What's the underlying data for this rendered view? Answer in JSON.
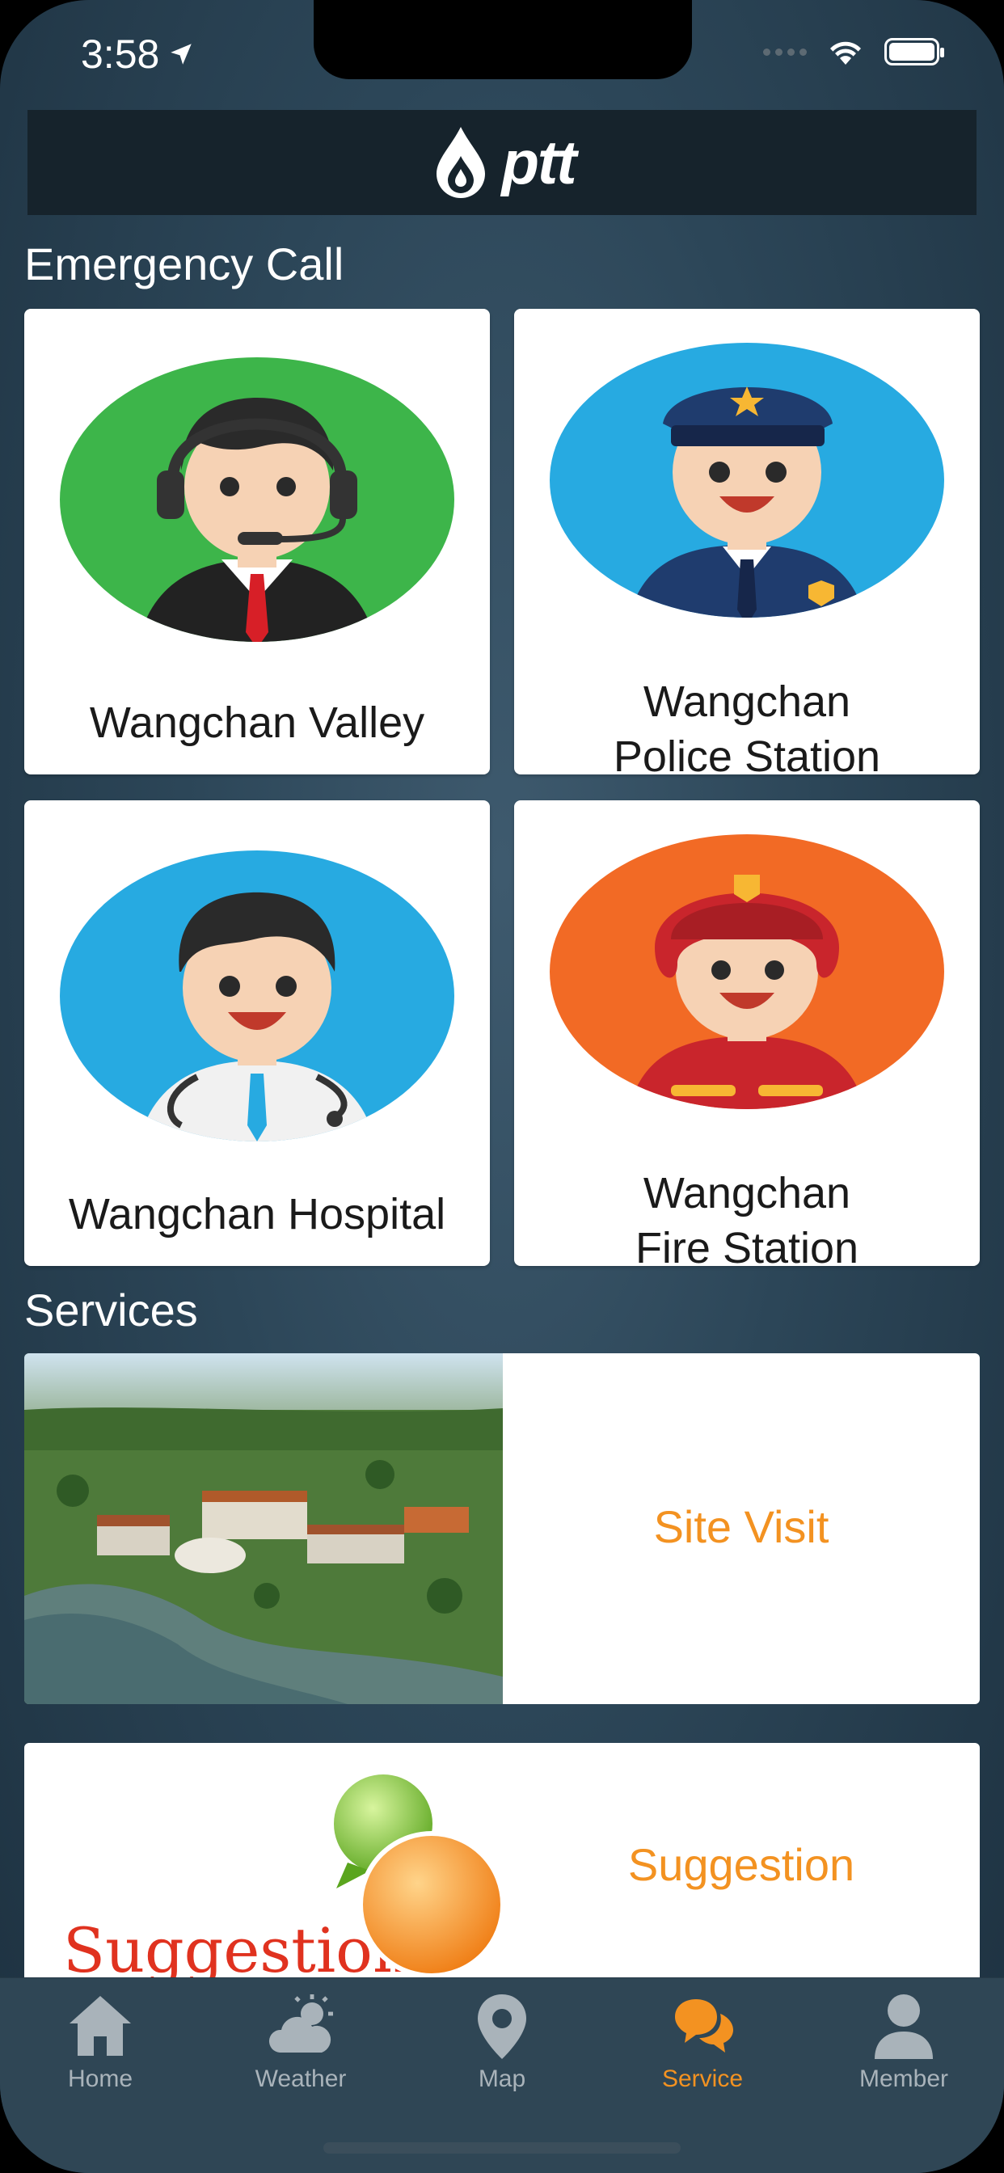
{
  "status": {
    "time": "3:58"
  },
  "header": {
    "logo_text": "ptt"
  },
  "emergency": {
    "title": "Emergency Call",
    "cards": [
      {
        "line1": "Wangchan Valley",
        "line2": ""
      },
      {
        "line1": "Wangchan",
        "line2": "Police Station"
      },
      {
        "line1": "Wangchan Hospital",
        "line2": ""
      },
      {
        "line1": "Wangchan",
        "line2": "Fire Station"
      }
    ]
  },
  "services": {
    "title": "Services",
    "items": [
      {
        "label": "Site Visit"
      },
      {
        "label": "Suggestion",
        "image_text": "Suggestions"
      }
    ]
  },
  "tabbar": {
    "tabs": [
      {
        "label": "Home",
        "icon": "home-icon"
      },
      {
        "label": "Weather",
        "icon": "weather-icon"
      },
      {
        "label": "Map",
        "icon": "map-pin-icon"
      },
      {
        "label": "Service",
        "icon": "chat-bubbles-icon",
        "active": true
      },
      {
        "label": "Member",
        "icon": "person-icon"
      }
    ]
  },
  "colors": {
    "accent": "#f39221",
    "header": "#16232c",
    "tabbar": "#2f4655"
  }
}
